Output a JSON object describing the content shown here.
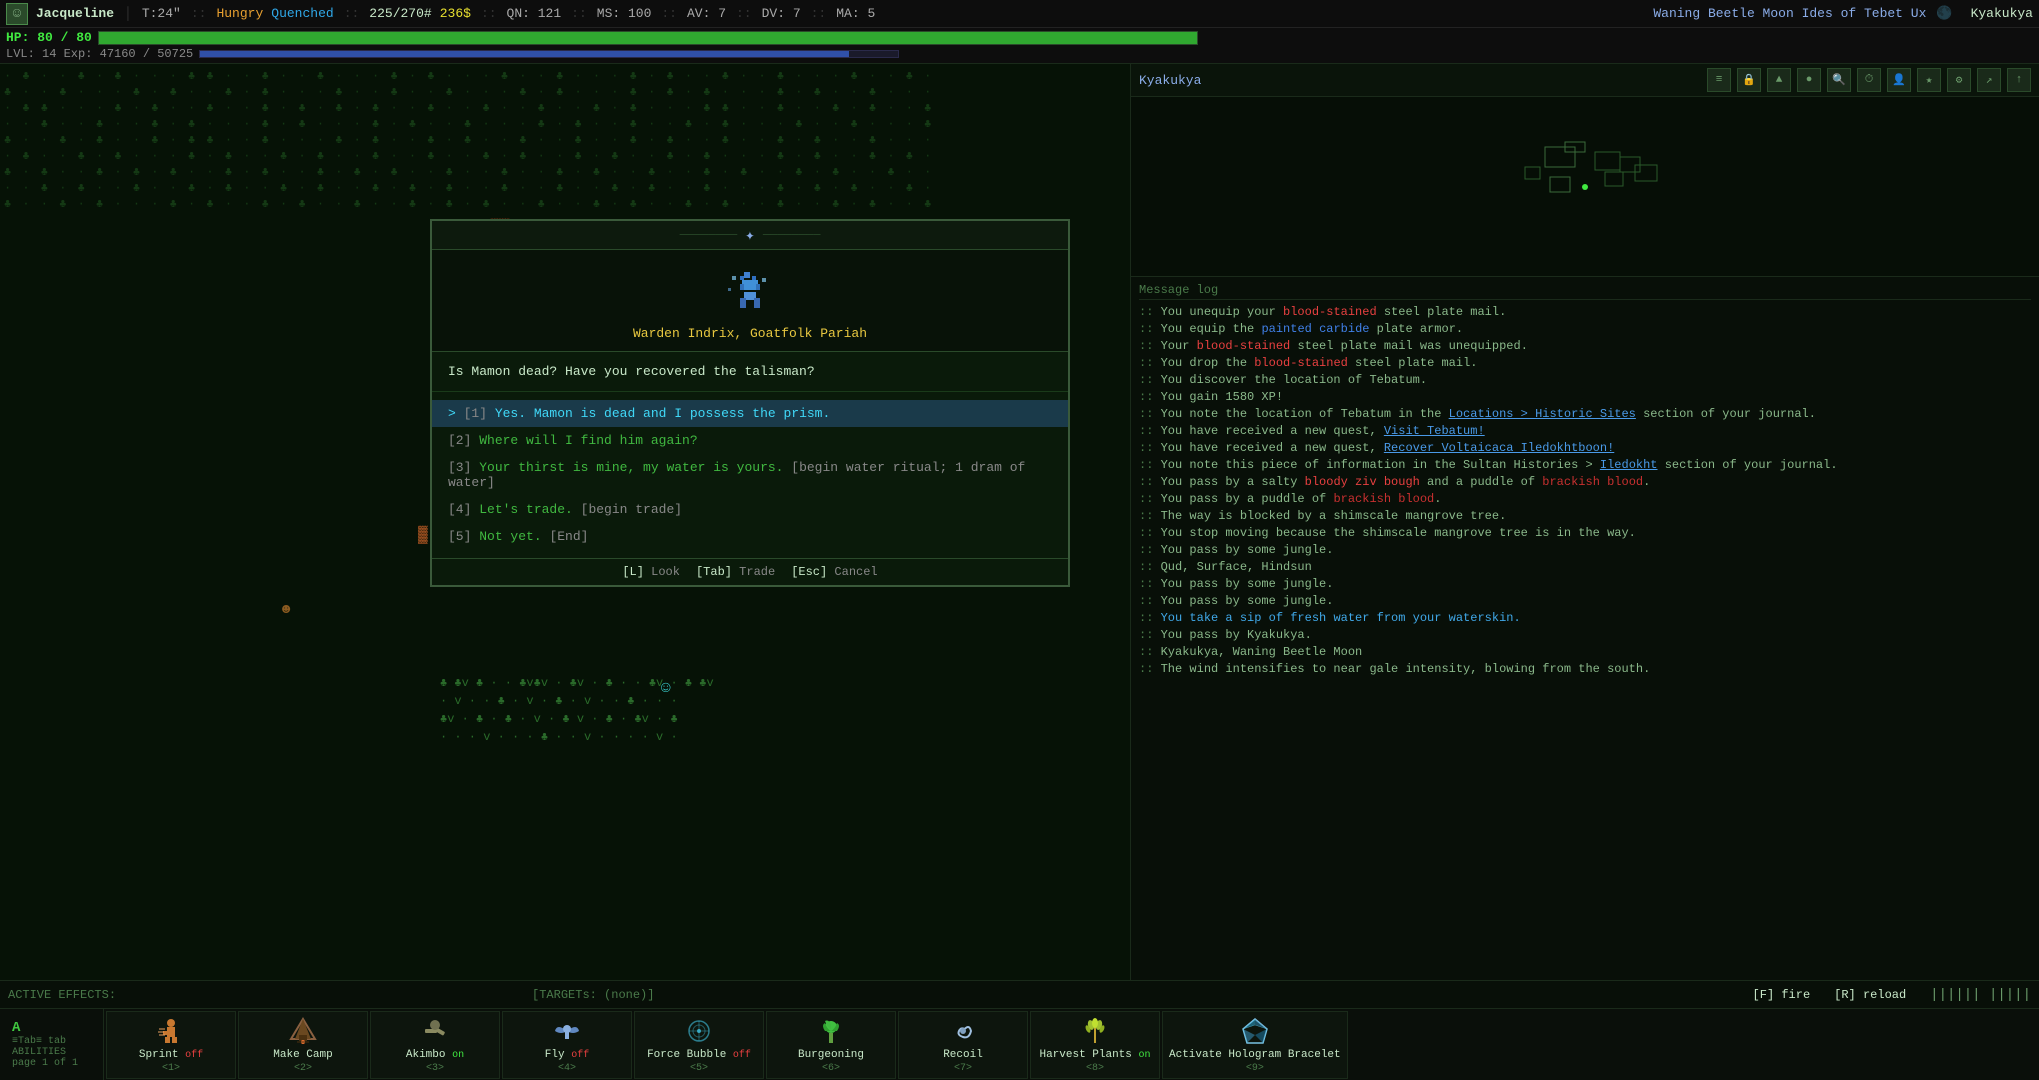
{
  "topbar": {
    "char_icon": "☺",
    "char_name": "Jacqueline",
    "time": "T:24\"",
    "status_hungry": "Hungry",
    "status_quenched": "Quenched",
    "hp": "225/270#",
    "money": "236$",
    "qn": "QN: 121",
    "ms": "MS: 100",
    "av": "AV: 7",
    "dv": "DV: 7",
    "ma": "MA: 5",
    "moon": "Waning Beetle Moon Ides of Tebet Ux",
    "player_right": "Kyakukya"
  },
  "hpbar": {
    "current": 80,
    "max": 80,
    "label": "HP: 80 / 80",
    "pct": 100
  },
  "xpbar": {
    "level": "LVL: 14",
    "exp_current": 47160,
    "exp_max": 50725,
    "label": "LVL: 14  Exp: 47160 / 50725",
    "pct": 93
  },
  "right_panel": {
    "location": "Kyakukya",
    "icons": [
      "≡",
      "🔒",
      "▲",
      "●",
      "🔍",
      "⏱",
      "👤",
      "★",
      "⚙",
      "↗",
      "↑"
    ]
  },
  "message_log": {
    "header": "Message log",
    "messages": [
      {
        "text": ":: You unequip your ",
        "highlight": "blood-stained",
        "rest": " steel plate mail."
      },
      {
        "text": ":: You equip the ",
        "highlight": "painted",
        "mid": " carbide",
        "rest": " plate armor."
      },
      {
        "text": ":: Your ",
        "highlight": "blood-stained",
        "rest": " steel plate mail was unequipped."
      },
      {
        "text": ":: You drop the ",
        "highlight": "blood-stained",
        "rest": " steel plate mail."
      },
      {
        "text": ":: You discover the location of Tebatum."
      },
      {
        "text": ":: You gain 1580 XP!"
      },
      {
        "text": ":: You note the location of Tebatum in the Locations > Historic Sites section of your journal."
      },
      {
        "text": ":: You have received a new quest, ",
        "link": "Visit Tebatum!",
        "rest": ""
      },
      {
        "text": ":: You have received a new quest, ",
        "link": "Recover Voltaicaca Iledokhtboon!",
        "rest": ""
      },
      {
        "text": ":: You note this piece of information in the Sultan Histories > Iledokht section of your journal."
      },
      {
        "text": ":: You pass by a salty ",
        "highlight": "bloody ziv bough",
        "rest": " and a puddle of ",
        "blood": "brackish blood",
        "end": "."
      },
      {
        "text": ":: You pass by a puddle of ",
        "blood": "brackish blood",
        "end": "."
      },
      {
        "text": ":: The way is blocked by a shimscale mangrove tree."
      },
      {
        "text": ":: You stop moving because the shimscale mangrove tree is in the way."
      },
      {
        "text": ":: You pass by some jungle."
      },
      {
        "text": ":: Qud, Surface, Hindsun"
      },
      {
        "text": ":: You pass by some jungle."
      },
      {
        "text": ":: You pass by some jungle."
      },
      {
        "text": ":: ",
        "water": "You take a sip of fresh water from your waterskin.",
        "rest": ""
      },
      {
        "text": ":: You pass by Kyakukya."
      },
      {
        "text": ":: Kyakukya, Waning Beetle Moon"
      },
      {
        "text": ":: The wind intensifies to near gale intensity, blowing from the south."
      }
    ]
  },
  "dialog": {
    "title_deco": "─────────────────────────",
    "npc_name": "Warden Indrix, Goatfolk Pariah",
    "question": "Is Mamon dead? Have you recovered the talisman?",
    "options": [
      {
        "num": 1,
        "text": "Yes. Mamon is dead and I possess the prism.",
        "selected": true,
        "extra": ""
      },
      {
        "num": 2,
        "text": "Where will I find him again?",
        "selected": false,
        "extra": ""
      },
      {
        "num": 3,
        "text": "Your thirst is mine, my water is yours.",
        "selected": false,
        "extra": "[begin water ritual; 1 dram of water]"
      },
      {
        "num": 4,
        "text": "Let's trade.",
        "selected": false,
        "extra": "[begin trade]"
      },
      {
        "num": 5,
        "text": "Not yet.",
        "selected": false,
        "extra": "[End]"
      }
    ],
    "footer": [
      {
        "key": "[L]",
        "action": "Look"
      },
      {
        "key": "[Tab]",
        "action": "Trade"
      },
      {
        "key": "[Esc]",
        "action": "Cancel"
      }
    ]
  },
  "active_effects": {
    "label": "ACTIVE EFFECTS:",
    "effects": "",
    "targets": "[TARGETs: (none)]",
    "fire_key": "[F] fire",
    "reload_key": "[R] reload"
  },
  "abilities": {
    "label": "A",
    "sublabel": "ABILITIES",
    "page": "page 1 of 1",
    "tab_hints": "≡Tab≡ tab",
    "slots": [
      {
        "icon": "🏃",
        "label": "Sprint",
        "status": "off",
        "key": "<1>",
        "status_type": "off"
      },
      {
        "icon": "⛺",
        "label": "Make Camp",
        "status": "",
        "key": "<2>",
        "status_type": "none"
      },
      {
        "icon": "👤",
        "label": "Akimbo",
        "status": "on",
        "key": "<3>",
        "status_type": "on"
      },
      {
        "icon": "✈",
        "label": "Fly",
        "status": "off",
        "key": "<4>",
        "status_type": "off"
      },
      {
        "icon": "◈",
        "label": "Force Bubble",
        "status": "off",
        "key": "<5>",
        "status_type": "off"
      },
      {
        "icon": "🌿",
        "label": "Burgeoning",
        "status": "",
        "key": "<6>",
        "status_type": "none"
      },
      {
        "icon": "💫",
        "label": "Recoil",
        "status": "",
        "key": "<7>",
        "status_type": "none"
      },
      {
        "icon": "🌾",
        "label": "Harvest Plants",
        "status": "on",
        "key": "<8>",
        "status_type": "on"
      },
      {
        "icon": "💎",
        "label": "Activate Hologram Bracelet",
        "status": "",
        "key": "<9>",
        "status_type": "none"
      }
    ]
  }
}
